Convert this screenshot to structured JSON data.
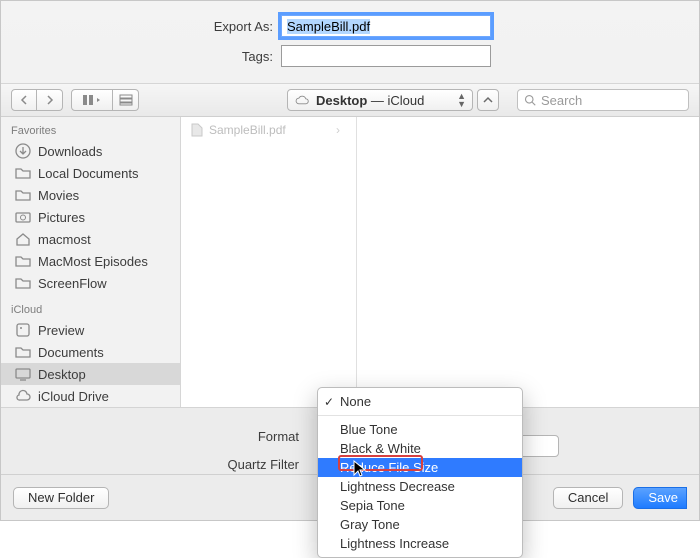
{
  "header": {
    "export_as_label": "Export As:",
    "export_as_value": "SampleBill.pdf",
    "tags_label": "Tags:",
    "tags_value": ""
  },
  "location_popup": {
    "folder": "Desktop",
    "suffix": " — iCloud"
  },
  "search": {
    "placeholder": "Search"
  },
  "sidebar": {
    "favorites_heading": "Favorites",
    "items": [
      {
        "icon": "download",
        "label": "Downloads"
      },
      {
        "icon": "folder",
        "label": "Local Documents"
      },
      {
        "icon": "folder",
        "label": "Movies"
      },
      {
        "icon": "camera",
        "label": "Pictures"
      },
      {
        "icon": "home",
        "label": "macmost"
      },
      {
        "icon": "folder",
        "label": "MacMost Episodes"
      },
      {
        "icon": "folder",
        "label": "ScreenFlow"
      }
    ],
    "icloud_heading": "iCloud",
    "icloud_items": [
      {
        "icon": "app",
        "label": "Preview"
      },
      {
        "icon": "folder",
        "label": "Documents"
      },
      {
        "icon": "desktop",
        "label": "Desktop",
        "selected": true
      },
      {
        "icon": "cloud",
        "label": "iCloud Drive"
      }
    ]
  },
  "file_column": {
    "items": [
      {
        "name": "SampleBill.pdf"
      }
    ]
  },
  "options": {
    "format_label": "Format",
    "quartz_filter_label": "Quartz Filter"
  },
  "quartz_menu": {
    "items": [
      {
        "label": "None",
        "checked": true
      },
      {
        "divider": true
      },
      {
        "label": "Blue Tone"
      },
      {
        "label": "Black & White"
      },
      {
        "label": "Reduce File Size",
        "selected": true
      },
      {
        "label": "Lightness Decrease"
      },
      {
        "label": "Sepia Tone"
      },
      {
        "label": "Gray Tone"
      },
      {
        "label": "Lightness Increase"
      }
    ]
  },
  "footer": {
    "new_folder": "New Folder",
    "cancel": "Cancel",
    "save": "Save"
  }
}
